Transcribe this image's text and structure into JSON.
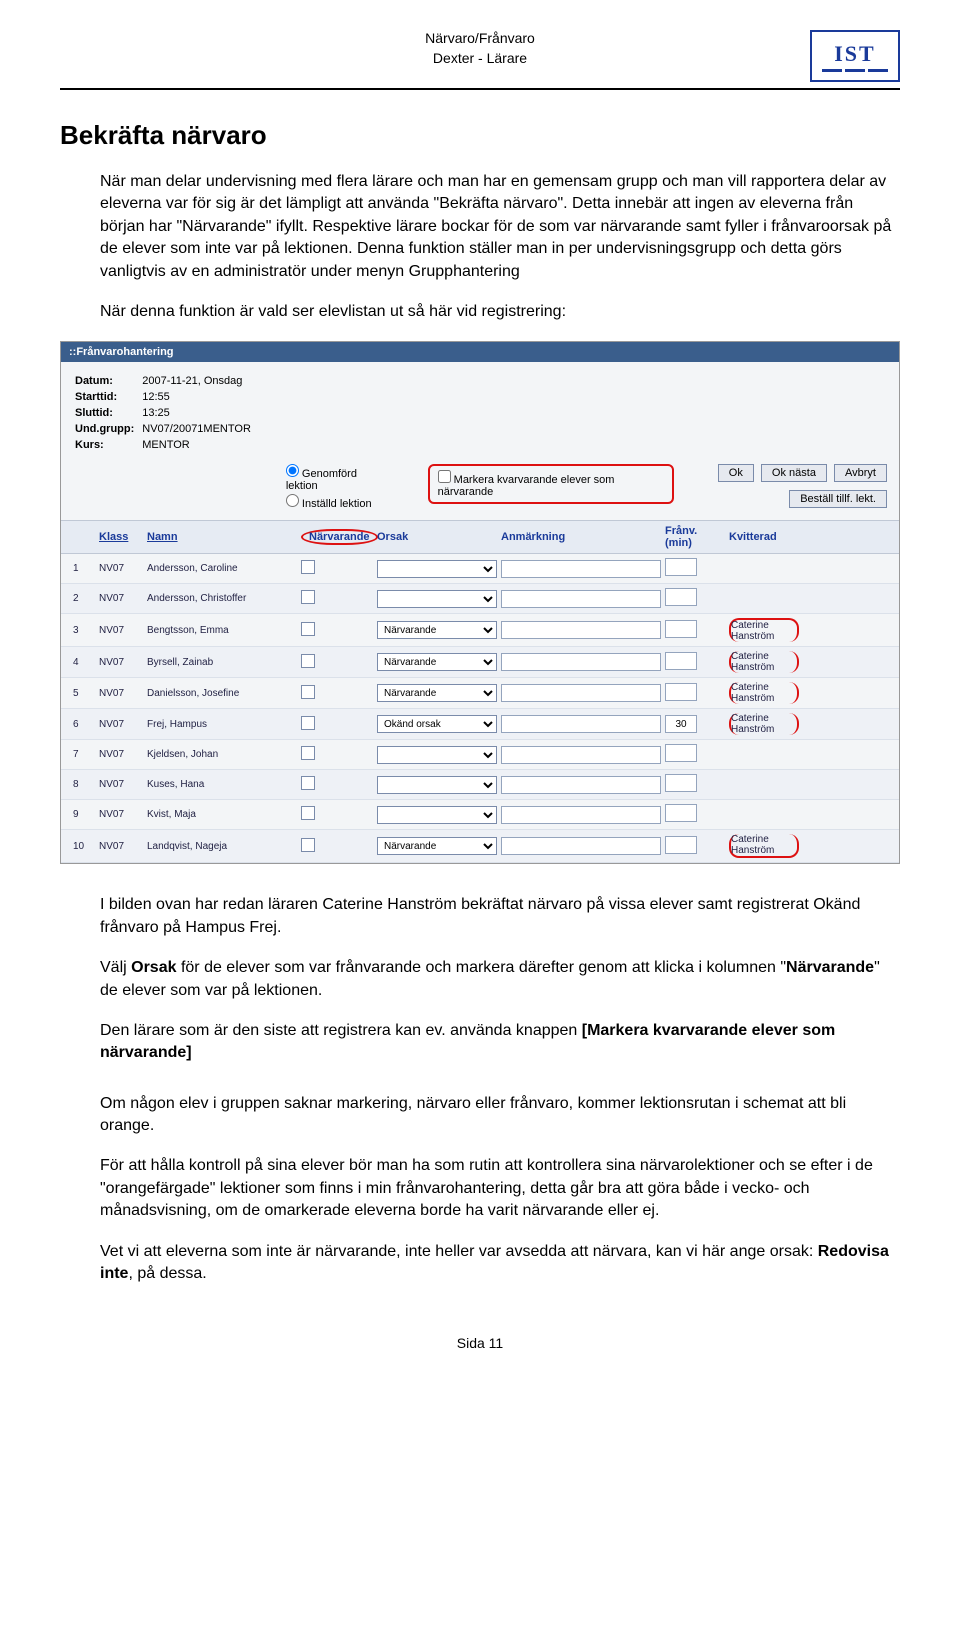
{
  "header": {
    "line1": "Närvaro/Frånvaro",
    "line2": "Dexter - Lärare"
  },
  "title": "Bekräfta närvaro",
  "intro1a": "När man delar undervisning med flera lärare och man har en gemensam grupp och man vill rapportera delar av eleverna var för sig är det lämpligt att använda \"Bekräfta närvaro\". Detta innebär att ingen av eleverna från början har \"Närvarande\" ifyllt. Respektive lärare bockar för de som var närvarande samt fyller i frånvaroorsak på de elever som inte var på lektionen. Denna funktion ställer man in per undervisningsgrupp och detta görs vanligtvis av en administratör under menyn Grupphantering",
  "intro1b": "När denna funktion är vald ser elevlistan ut så här vid registrering:",
  "para2": "I bilden ovan har redan läraren Caterine Hanström bekräftat närvaro på vissa elever samt registrerat Okänd frånvaro på Hampus Frej.",
  "para3": "Välj Orsak för de elever som var frånvarande och markera därefter genom att klicka i kolumnen \"Närvarande\" de elever som var på lektionen.",
  "para4": "Den lärare som är den siste att registrera kan ev. använda knappen [Markera kvarvarande elever som närvarande]",
  "para5": "Om någon elev i gruppen saknar markering, närvaro eller frånvaro, kommer lektionsrutan i schemat att bli orange.",
  "para6": "För att hålla kontroll på sina elever bör man ha som rutin att kontrollera sina närvarolektioner och se efter i de \"orangefärgade\" lektioner som finns i min frånvarohantering, detta går bra att göra både i vecko- och månadsvisning, om de omarkerade eleverna borde ha varit närvarande eller ej.",
  "para7": "Vet vi att eleverna som inte är närvarande, inte heller var avsedda att närvara, kan vi här ange orsak: Redovisa inte, på dessa.",
  "footer": "Sida 11",
  "app": {
    "title": "::Frånvarohantering",
    "meta": {
      "l_date": "Datum:",
      "v_date": "2007-11-21, Onsdag",
      "l_start": "Starttid:",
      "v_start": "12:55",
      "l_end": "Sluttid:",
      "v_end": "13:25",
      "l_grp": "Und.grupp:",
      "v_grp": "NV07/20071MENTOR",
      "l_kurs": "Kurs:",
      "v_kurs": "MENTOR"
    },
    "radio1": "Genomförd lektion",
    "radio2": "Inställd lektion",
    "check_label": "Markera kvarvarande elever som närvarande",
    "btn_ok": "Ok",
    "btn_next": "Ok nästa",
    "btn_cancel": "Avbryt",
    "btn_order": "Beställ tillf. lekt.",
    "cols": {
      "klass": "Klass",
      "namn": "Namn",
      "narv": "Närvarande",
      "orsak": "Orsak",
      "anm": "Anmärkning",
      "min": "Frånv. (min)",
      "kv": "Kvitterad"
    },
    "rows": [
      {
        "n": "1",
        "klass": "NV07",
        "namn": "Andersson, Caroline",
        "orsak": "",
        "min": "",
        "kv": ""
      },
      {
        "n": "2",
        "klass": "NV07",
        "namn": "Andersson, Christoffer",
        "orsak": "",
        "min": "",
        "kv": ""
      },
      {
        "n": "3",
        "klass": "NV07",
        "namn": "Bengtsson, Emma",
        "orsak": "Närvarande",
        "min": "",
        "kv": "Caterine Hanström"
      },
      {
        "n": "4",
        "klass": "NV07",
        "namn": "Byrsell, Zainab",
        "orsak": "Närvarande",
        "min": "",
        "kv": "Caterine Hanström"
      },
      {
        "n": "5",
        "klass": "NV07",
        "namn": "Danielsson, Josefine",
        "orsak": "Närvarande",
        "min": "",
        "kv": "Caterine Hanström"
      },
      {
        "n": "6",
        "klass": "NV07",
        "namn": "Frej, Hampus",
        "orsak": "Okänd orsak",
        "min": "30",
        "kv": "Caterine Hanström"
      },
      {
        "n": "7",
        "klass": "NV07",
        "namn": "Kjeldsen, Johan",
        "orsak": "",
        "min": "",
        "kv": ""
      },
      {
        "n": "8",
        "klass": "NV07",
        "namn": "Kuses, Hana",
        "orsak": "",
        "min": "",
        "kv": ""
      },
      {
        "n": "9",
        "klass": "NV07",
        "namn": "Kvist, Maja",
        "orsak": "",
        "min": "",
        "kv": ""
      },
      {
        "n": "10",
        "klass": "NV07",
        "namn": "Landqvist, Nageja",
        "orsak": "Närvarande",
        "min": "",
        "kv": "Caterine Hanström"
      }
    ]
  }
}
